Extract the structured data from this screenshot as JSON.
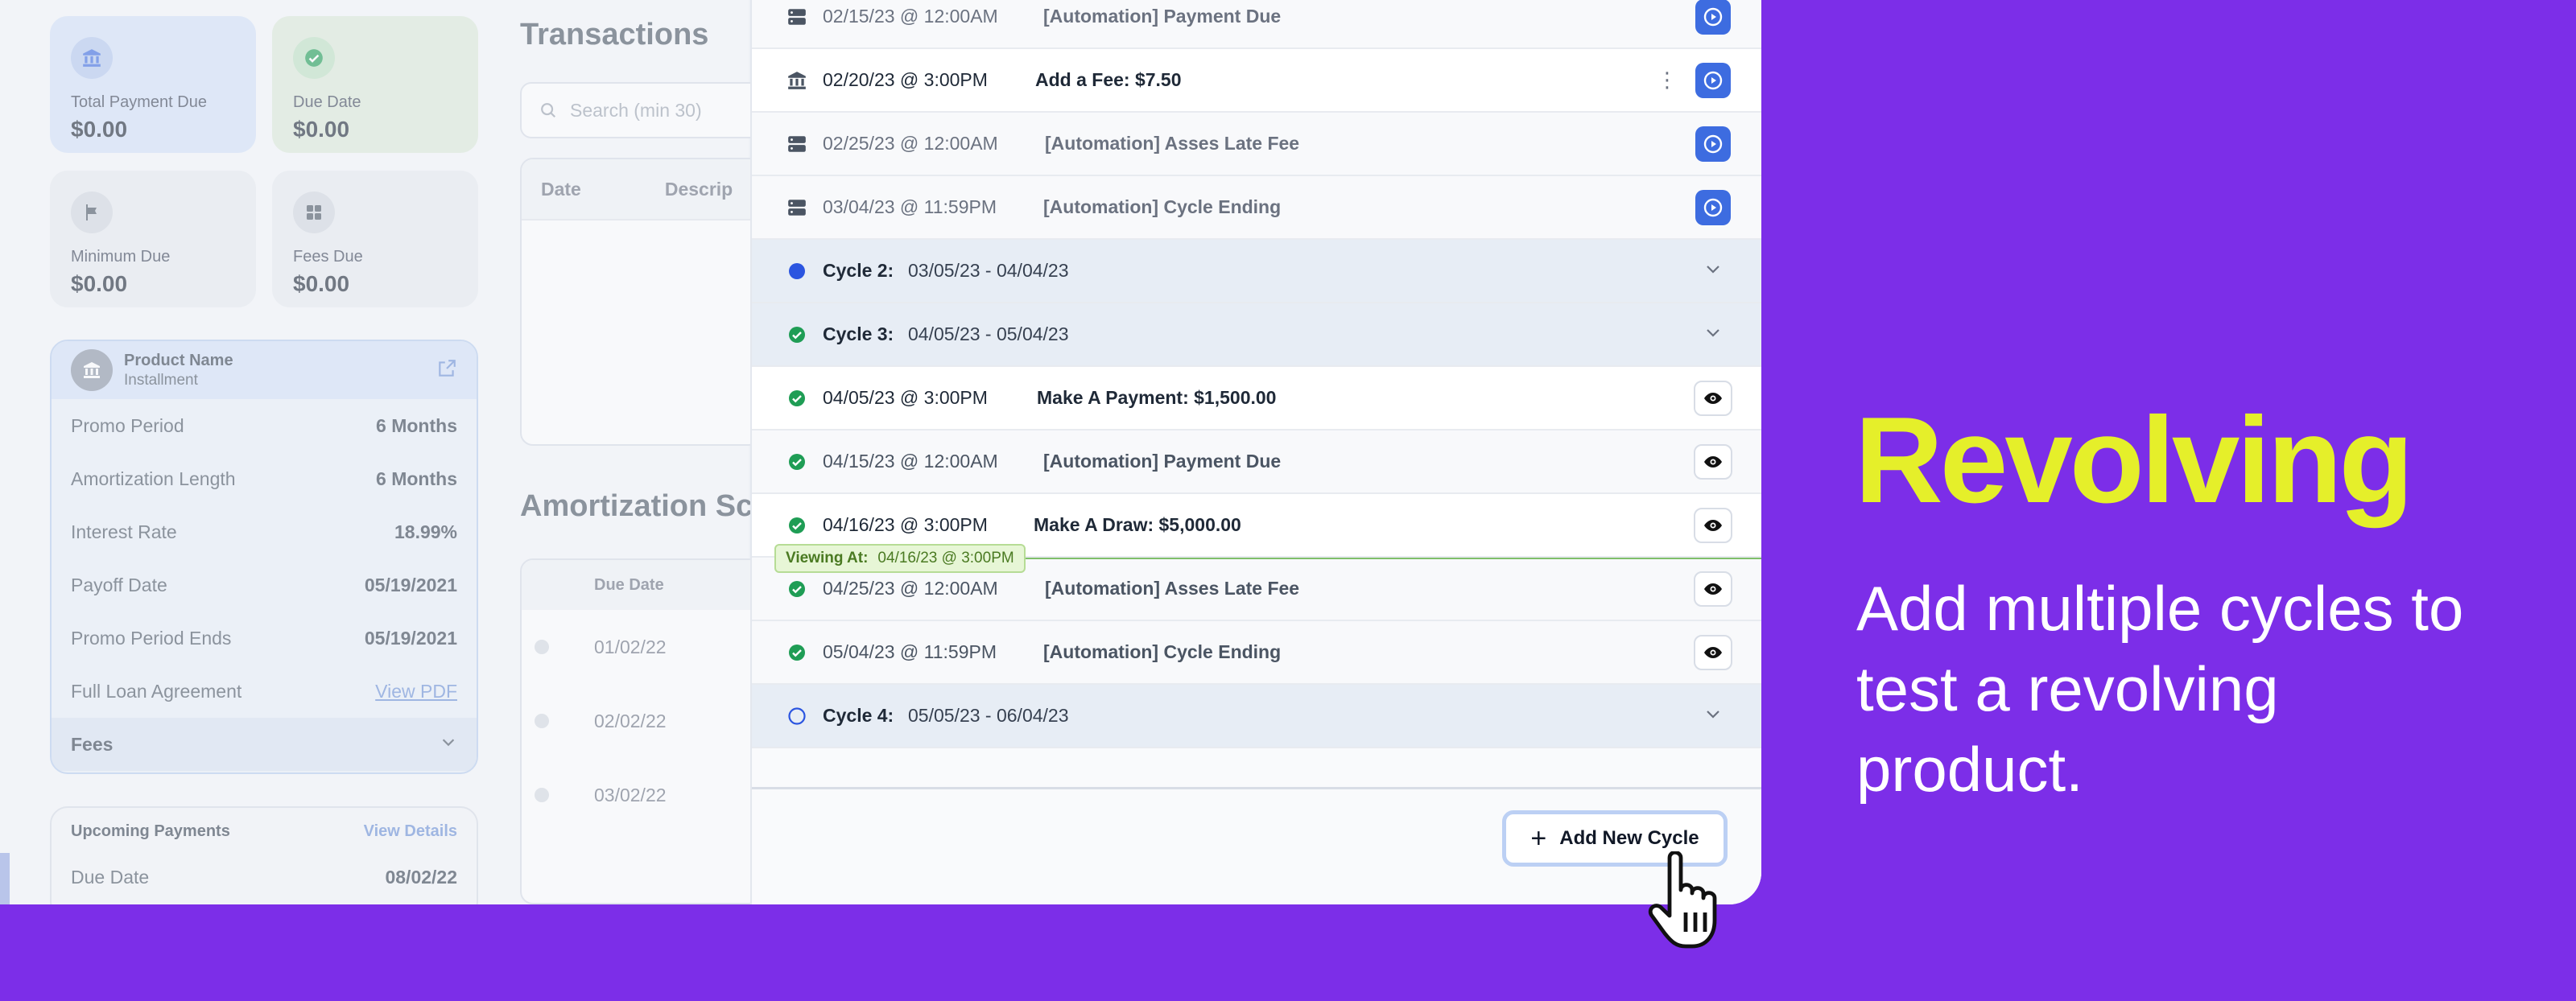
{
  "sidebar": {
    "stats": [
      {
        "label": "Total Payment Due",
        "value": "$0.00",
        "icon": "bank-icon"
      },
      {
        "label": "Due Date",
        "value": "$0.00",
        "icon": "check-circle-icon"
      },
      {
        "label": "Minimum Due",
        "value": "$0.00",
        "icon": "flag-icon"
      },
      {
        "label": "Fees Due",
        "value": "$0.00",
        "icon": "grid-icon"
      }
    ],
    "product": {
      "name": "Product Name",
      "type": "Installment",
      "rows": [
        {
          "label": "Promo Period",
          "value": "6 Months"
        },
        {
          "label": "Amortization Length",
          "value": "6 Months"
        },
        {
          "label": "Interest Rate",
          "value": "18.99%"
        },
        {
          "label": "Payoff Date",
          "value": "05/19/2021"
        },
        {
          "label": "Promo Period Ends",
          "value": "05/19/2021"
        }
      ],
      "agreement_label": "Full Loan Agreement",
      "agreement_link": "View PDF",
      "fees_label": "Fees"
    },
    "upcoming": {
      "title": "Upcoming Payments",
      "link": "View Details",
      "due_label": "Due Date",
      "due_value": "08/02/22"
    }
  },
  "middle": {
    "transactions_title": "Transactions",
    "search_placeholder": "Search (min 30)",
    "col_date": "Date",
    "col_desc": "Descrip",
    "amortization_title": "Amortization Sc",
    "am_col_due": "Due Date",
    "am_rows": [
      "01/02/22",
      "02/02/22",
      "03/02/22"
    ]
  },
  "timeline": {
    "rows": [
      {
        "date": "02/15/23 @ 12:00AM",
        "event": "[Automation] Payment Due"
      },
      {
        "date": "02/20/23 @ 3:00PM",
        "event": "Add a Fee: $7.50"
      },
      {
        "date": "02/25/23 @ 12:00AM",
        "event": "[Automation] Asses Late Fee"
      },
      {
        "date": "03/04/23 @ 11:59PM",
        "event": "[Automation] Cycle Ending"
      },
      {
        "cycle": "Cycle 2:",
        "range": "03/05/23 - 04/04/23"
      },
      {
        "cycle": "Cycle 3:",
        "range": "04/05/23 - 05/04/23"
      },
      {
        "date": "04/05/23 @ 3:00PM",
        "event": "Make A Payment: $1,500.00"
      },
      {
        "date": "04/15/23 @ 12:00AM",
        "event": "[Automation] Payment Due"
      },
      {
        "date": "04/16/23 @ 3:00PM",
        "event": "Make A Draw: $5,000.00"
      },
      {
        "date": "04/25/23 @ 12:00AM",
        "event": "[Automation] Asses Late Fee"
      },
      {
        "date": "05/04/23 @ 11:59PM",
        "event": "[Automation] Cycle Ending"
      },
      {
        "cycle": "Cycle 4:",
        "range": "05/05/23 - 06/04/23"
      }
    ],
    "viewing_label": "Viewing At:",
    "viewing_value": "04/16/23 @ 3:00PM",
    "add_cycle_label": "Add New Cycle"
  },
  "marketing": {
    "headline": "Revolving",
    "subtext": "Add multiple  cycles to test a revolving product."
  },
  "colors": {
    "background": "#7c2ee8",
    "headline": "#e5ef2a",
    "accent": "#3d6ce0",
    "success": "#1f9d55"
  }
}
